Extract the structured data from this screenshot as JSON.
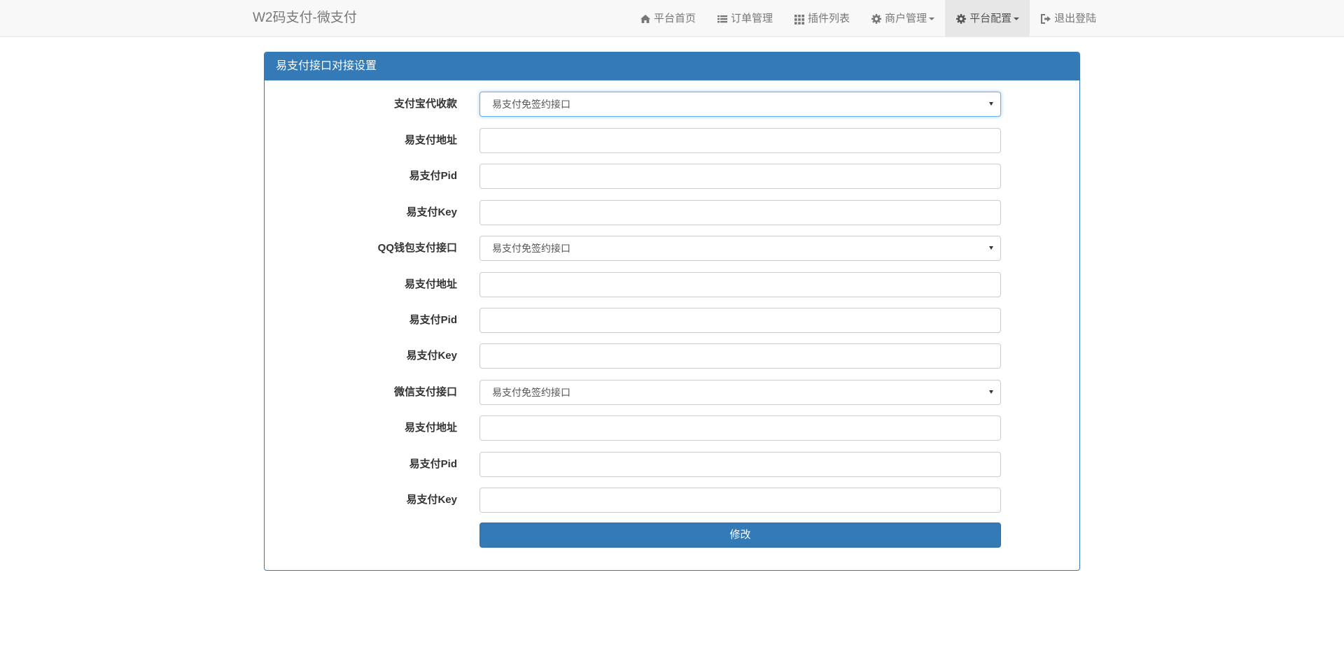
{
  "navbar": {
    "brand": "W2码支付-微支付",
    "items": [
      {
        "icon": "home-icon",
        "label": "平台首页"
      },
      {
        "icon": "list-icon",
        "label": "订单管理"
      },
      {
        "icon": "grid-icon",
        "label": "插件列表"
      },
      {
        "icon": "gear-icon",
        "label": "商户管理"
      },
      {
        "icon": "gear-icon",
        "label": "平台配置"
      },
      {
        "icon": "logout-icon",
        "label": "退出登陆"
      }
    ]
  },
  "panel": {
    "title": "易支付接口对接设置",
    "alipay": {
      "select_label": "支付宝代收款",
      "select_value": "易支付免签约接口",
      "url_label": "易支付地址",
      "url_value": "",
      "pid_label": "易支付Pid",
      "pid_value": "",
      "key_label": "易支付Key",
      "key_value": ""
    },
    "qq": {
      "select_label": "QQ钱包支付接口",
      "select_value": "易支付免签约接口",
      "url_label": "易支付地址",
      "url_value": "",
      "pid_label": "易支付Pid",
      "pid_value": "",
      "key_label": "易支付Key",
      "key_value": ""
    },
    "wechat": {
      "select_label": "微信支付接口",
      "select_value": "易支付免签约接口",
      "url_label": "易支付地址",
      "url_value": "",
      "pid_label": "易支付Pid",
      "pid_value": "",
      "key_label": "易支付Key",
      "key_value": ""
    },
    "submit_label": "修改"
  },
  "colors": {
    "primary": "#337ab7",
    "navbar_bg": "#f8f8f8",
    "active_nav_bg": "#e7e7e7"
  }
}
